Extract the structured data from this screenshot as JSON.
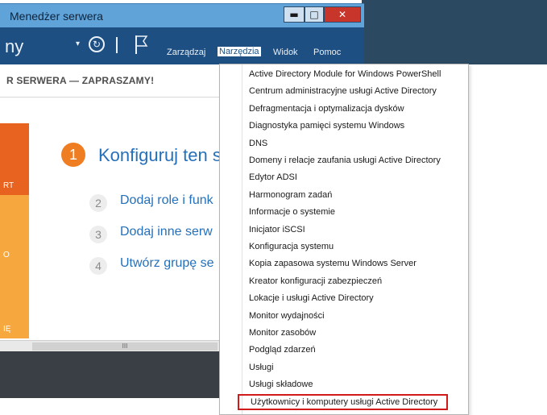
{
  "window": {
    "title": "Menedżer serwera",
    "minimize_glyph": "▬",
    "maximize_glyph": "□",
    "close_glyph": "✕"
  },
  "toolbar": {
    "app_title": "ny",
    "arrow_glyph": "▾",
    "refresh_glyph": "↻",
    "menu": [
      "Zarządzaj",
      "Narzędzia",
      "Widok",
      "Pomoc"
    ]
  },
  "content": {
    "welcome_banner": "R SERWERA — ZAPRASZAMY!",
    "tile_labels": [
      "RT",
      "O",
      "IĘ"
    ],
    "steps": [
      {
        "num": "1",
        "text": "Konfiguruj ten s"
      },
      {
        "num": "2",
        "text": "Dodaj role i funk"
      },
      {
        "num": "3",
        "text": "Dodaj inne serw"
      },
      {
        "num": "4",
        "text": "Utwórz grupę se"
      }
    ],
    "scrollbar_grip": "III"
  },
  "dropdown": {
    "items": [
      "Active Directory Module for Windows PowerShell",
      "Centrum administracyjne usługi Active Directory",
      "Defragmentacja i optymalizacja dysków",
      "Diagnostyka pamięci systemu Windows",
      "DNS",
      "Domeny i relacje zaufania usługi Active Directory",
      "Edytor ADSI",
      "Harmonogram zadań",
      "Informacje o systemie",
      "Inicjator iSCSI",
      "Konfiguracja systemu",
      "Kopia zapasowa systemu Windows Server",
      "Kreator konfiguracji zabezpieczeń",
      "Lokacje i usługi Active Directory",
      "Monitor wydajności",
      "Monitor zasobów",
      "Podgląd zdarzeń",
      "Usługi",
      "Usługi składowe",
      "Użytkownicy i komputery usługi Active Directory"
    ],
    "selected_index": 19
  },
  "colors": {
    "title_bar": "#5fa3d8",
    "toolbar": "#1d4f83",
    "close_button": "#c8352b",
    "step_accent": "#ef7d22",
    "link_blue": "#2570ba",
    "highlight_border": "#d11a1a",
    "tile_orange": "#e8631f",
    "tile_yellow": "#f6a83e"
  }
}
